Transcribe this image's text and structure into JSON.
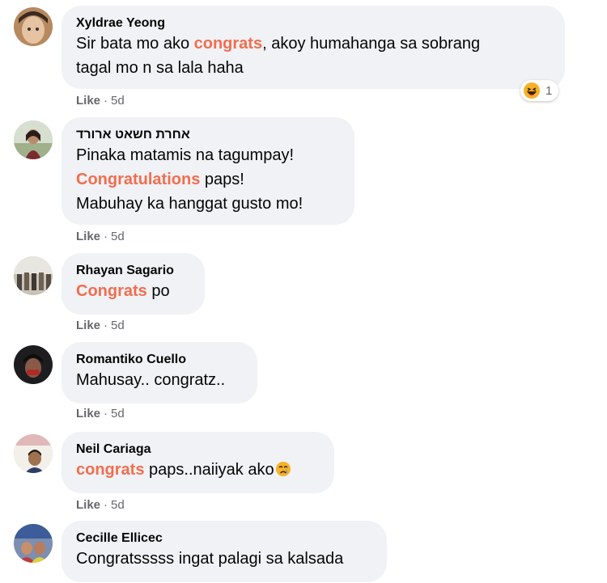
{
  "comments": [
    {
      "author": "Xyldrae Yeong",
      "lines": [
        {
          "pre": "Sir bata mo ako ",
          "hl": "congrats",
          "post": ", akoy humahanga sa sobrang"
        },
        {
          "pre": "tagal mo n sa lala haha",
          "hl": "",
          "post": ""
        }
      ],
      "like": "Like",
      "time": "5d",
      "reaction": {
        "icon": "laugh-emoji-icon",
        "count": "1"
      }
    },
    {
      "author": "אחרת חשאט ארורד",
      "lines": [
        {
          "pre": "Pinaka matamis na tagumpay!",
          "hl": "",
          "post": ""
        },
        {
          "pre": "",
          "hl": "Congratulations",
          "post": " paps!"
        },
        {
          "pre": "Mabuhay ka hanggat gusto mo!",
          "hl": "",
          "post": ""
        }
      ],
      "like": "Like",
      "time": "5d"
    },
    {
      "author": "Rhayan Sagario",
      "lines": [
        {
          "pre": "",
          "hl": "Congrats",
          "post": " po"
        }
      ],
      "like": "Like",
      "time": "5d"
    },
    {
      "author": "Romantiko Cuello",
      "lines": [
        {
          "pre": "Mahusay.. congratz..",
          "hl": "",
          "post": ""
        }
      ],
      "like": "Like",
      "time": "5d"
    },
    {
      "author": "Neil Cariaga",
      "lines": [
        {
          "pre": "",
          "hl": "congrats",
          "post": " paps..naiiyak ako"
        }
      ],
      "emoji": "crying-face-icon",
      "like": "Like",
      "time": "5d"
    },
    {
      "author": "Cecille Ellicec",
      "lines": [
        {
          "pre": "Congratsssss ingat palagi sa kalsada",
          "hl": "",
          "post": ""
        }
      ]
    }
  ],
  "colors": {
    "bubble": "#f0f2f5",
    "highlight": "#f26d4f",
    "meta": "#65676b"
  }
}
